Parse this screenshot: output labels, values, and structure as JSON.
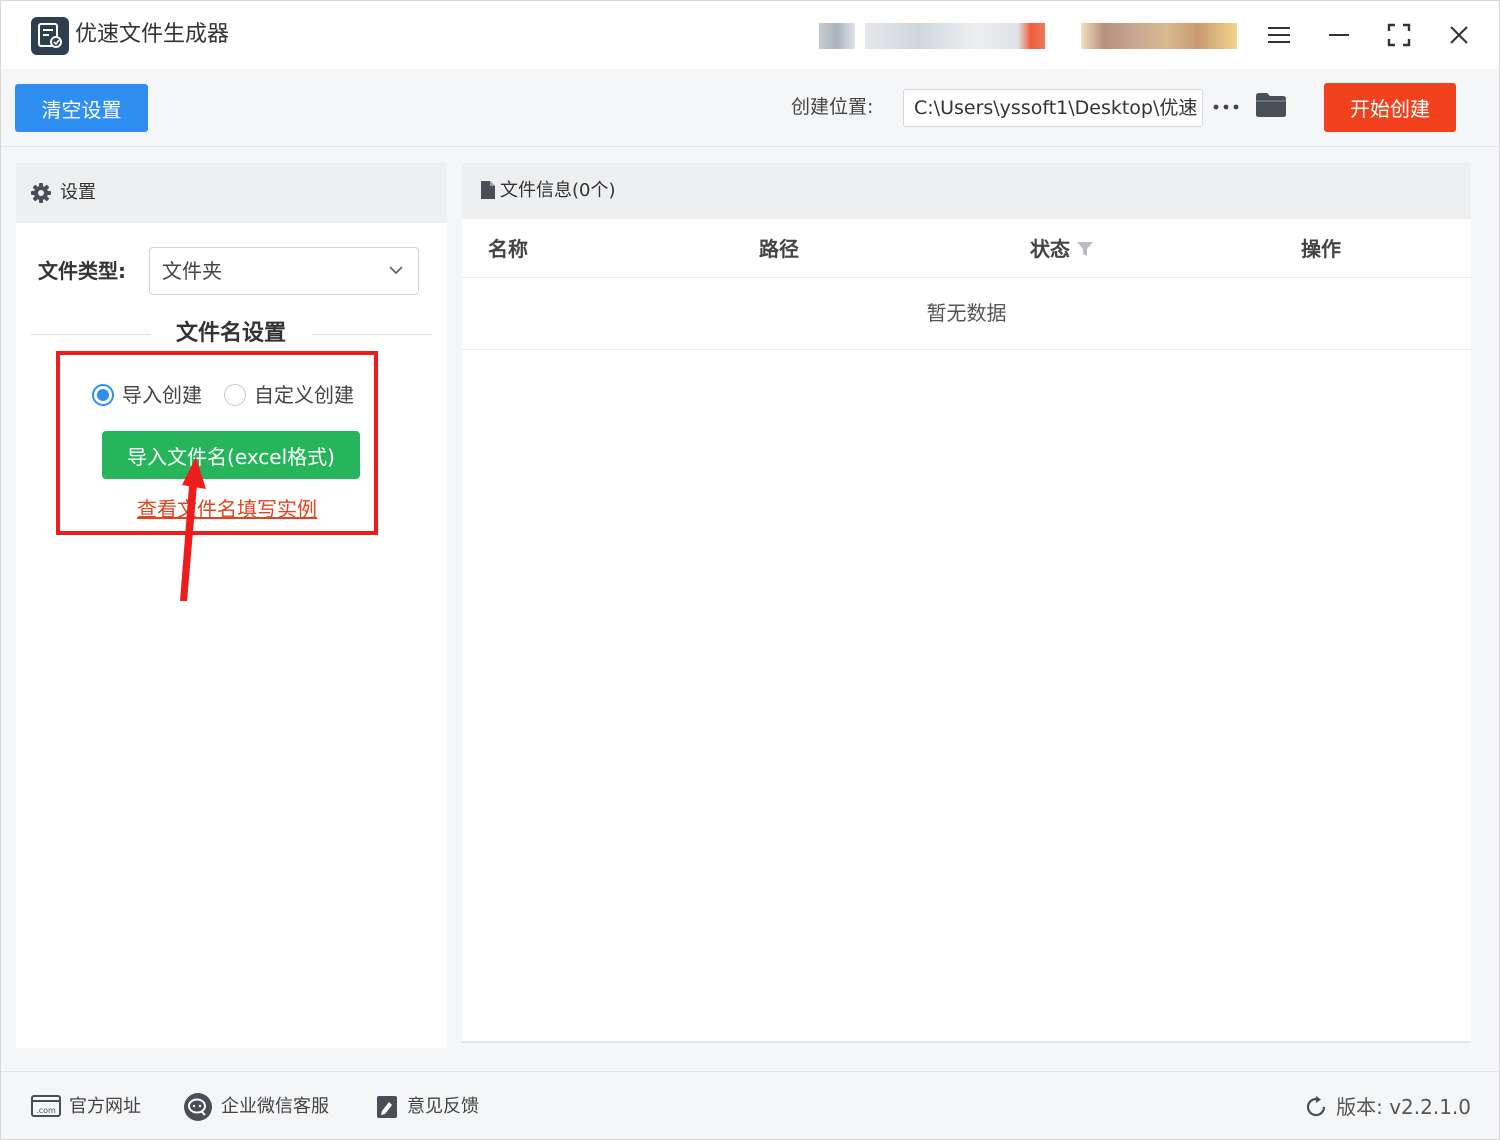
{
  "app": {
    "title": "优速文件生成器",
    "icon": "file-refresh-icon"
  },
  "titlebar": {
    "buttons": [
      "menu-icon",
      "minimize-icon",
      "maximize-icon",
      "close-icon"
    ]
  },
  "toolbar": {
    "clear_label": "清空设置",
    "location_label": "创建位置:",
    "location_value": "C:\\Users\\yssoft1\\Desktop\\优速",
    "more_label": "···",
    "start_label": "开始创建"
  },
  "settings": {
    "header": "设置",
    "file_type_label": "文件类型:",
    "file_type_value": "文件夹",
    "section_title": "文件名设置",
    "radio_import": "导入创建",
    "radio_custom": "自定义创建",
    "import_button": "导入文件名(excel格式)",
    "example_link": "查看文件名填写实例"
  },
  "file_info": {
    "header": "文件信息(0个)",
    "columns": [
      "名称",
      "路径",
      "状态",
      "操作"
    ],
    "empty_text": "暂无数据"
  },
  "footer": {
    "site": "官方网址",
    "wechat": "企业微信客服",
    "feedback": "意见反馈",
    "version": "版本: v2.2.1.0"
  },
  "colors": {
    "primary_blue": "#2e8ff0",
    "start_red": "#f1411f",
    "import_green": "#27b55c",
    "highlight_red": "#ee1c1c",
    "link_orange": "#e3431e"
  }
}
